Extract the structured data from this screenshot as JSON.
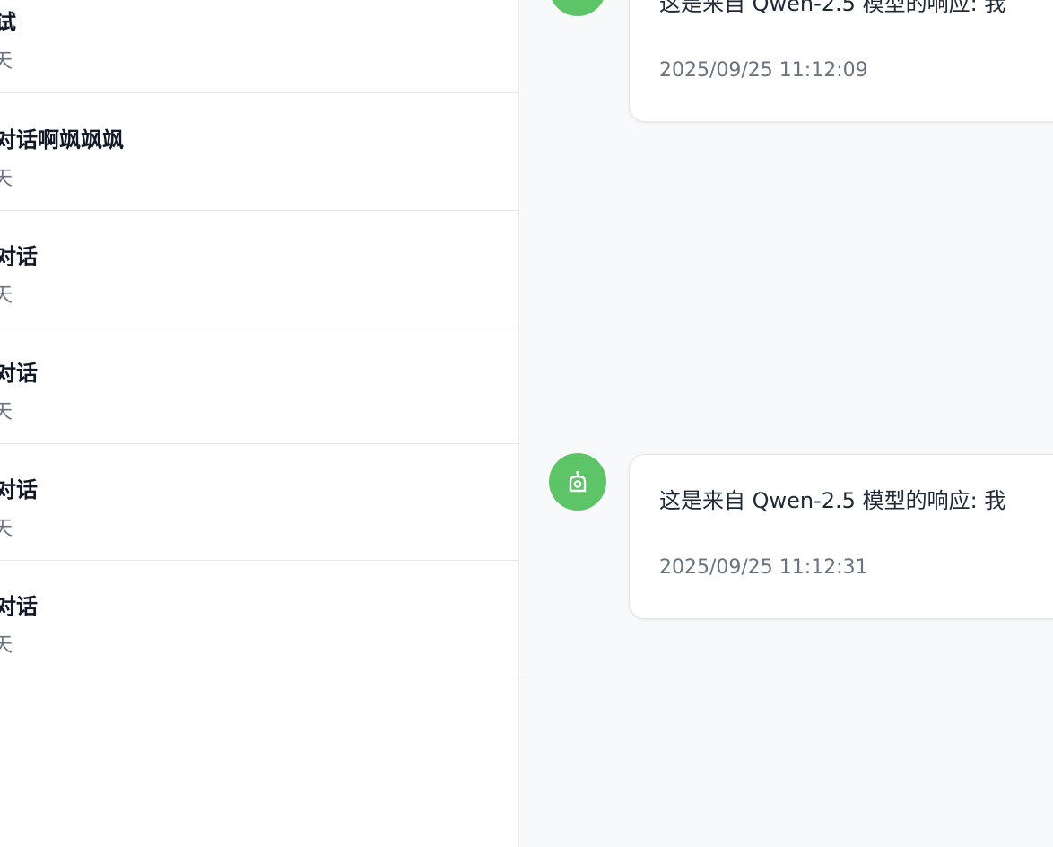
{
  "sidebar": {
    "items": [
      {
        "title": "试",
        "subtitle": "天"
      },
      {
        "title": "对话啊飒飒飒",
        "subtitle": "天"
      },
      {
        "title": "对话",
        "subtitle": "天"
      },
      {
        "title": "对话",
        "subtitle": "天"
      },
      {
        "title": "对话",
        "subtitle": "天"
      },
      {
        "title": "对话",
        "subtitle": "天"
      }
    ]
  },
  "chat": {
    "messages": [
      {
        "text": "这是来自 Qwen-2.5 模型的响应: 我",
        "time": "2025/09/25 11:12:09"
      },
      {
        "text": "这是来自 Qwen-2.5 模型的响应: 我",
        "time": "2025/09/25 11:12:31"
      }
    ],
    "avatar_icon": "robot-icon",
    "accent_color": "#5dc468"
  }
}
